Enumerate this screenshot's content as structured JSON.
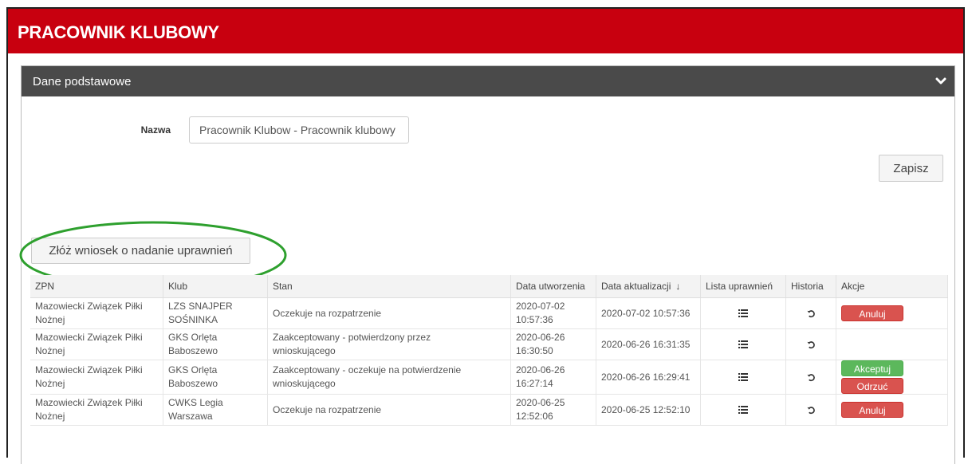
{
  "header": {
    "title": "PRACOWNIK KLUBOWY"
  },
  "panel": {
    "title": "Dane podstawowe",
    "toggle_icon": "chevron-down-icon"
  },
  "form": {
    "name_label": "Nazwa",
    "name_value": "Pracownik Klubow - Pracownik klubowy",
    "save_label": "Zapisz"
  },
  "request_button": {
    "label": "Złóż wniosek o nadanie uprawnień"
  },
  "colors": {
    "header_bg": "#c8000f",
    "panel_head_bg": "#4a4a4a",
    "danger": "#d9534f",
    "success": "#5cb85c",
    "annotation": "#2ea02e"
  },
  "table": {
    "columns": {
      "zpn": "ZPN",
      "klub": "Klub",
      "stan": "Stan",
      "created": "Data utworzenia",
      "updated": "Data aktualizacji",
      "updated_sort": "↓",
      "permissions": "Lista uprawnień",
      "history": "Historia",
      "actions": "Akcje"
    },
    "rows": [
      {
        "zpn_line1": "Mazowiecki Związek Piłki",
        "zpn_line2": "Nożnej",
        "klub_line1": "LZS SNAJPER",
        "klub_line2": "SOŚNINKA",
        "stan": "Oczekuje na rozpatrzenie",
        "stan_line2": "",
        "created_date": "2020-07-02",
        "created_time": "10:57:36",
        "updated": "2020-07-02 10:57:36",
        "actions": [
          "Anuluj"
        ]
      },
      {
        "zpn_line1": "Mazowiecki Związek Piłki",
        "zpn_line2": "Nożnej",
        "klub_line1": "GKS Orlęta",
        "klub_line2": "Baboszewo",
        "stan": "Zaakceptowany - potwierdzony przez",
        "stan_line2": "wnioskującego",
        "created_date": "2020-06-26",
        "created_time": "16:30:50",
        "updated": "2020-06-26 16:31:35",
        "actions": []
      },
      {
        "zpn_line1": "Mazowiecki Związek Piłki",
        "zpn_line2": "Nożnej",
        "klub_line1": "GKS Orlęta",
        "klub_line2": "Baboszewo",
        "stan": "Zaakceptowany - oczekuje na potwierdzenie",
        "stan_line2": "wnioskującego",
        "created_date": "2020-06-26",
        "created_time": "16:27:14",
        "updated": "2020-06-26 16:29:41",
        "actions": [
          "Akceptuj",
          "Odrzuć"
        ]
      },
      {
        "zpn_line1": "Mazowiecki Związek Piłki",
        "zpn_line2": "Nożnej",
        "klub_line1": "CWKS Legia",
        "klub_line2": "Warszawa",
        "stan": "Oczekuje na rozpatrzenie",
        "stan_line2": "",
        "created_date": "2020-06-25",
        "created_time": "12:52:06",
        "updated": "2020-06-25 12:52:10",
        "actions": [
          "Anuluj"
        ]
      }
    ],
    "row_icons": {
      "permissions": "list-icon",
      "history": "history-icon"
    }
  }
}
